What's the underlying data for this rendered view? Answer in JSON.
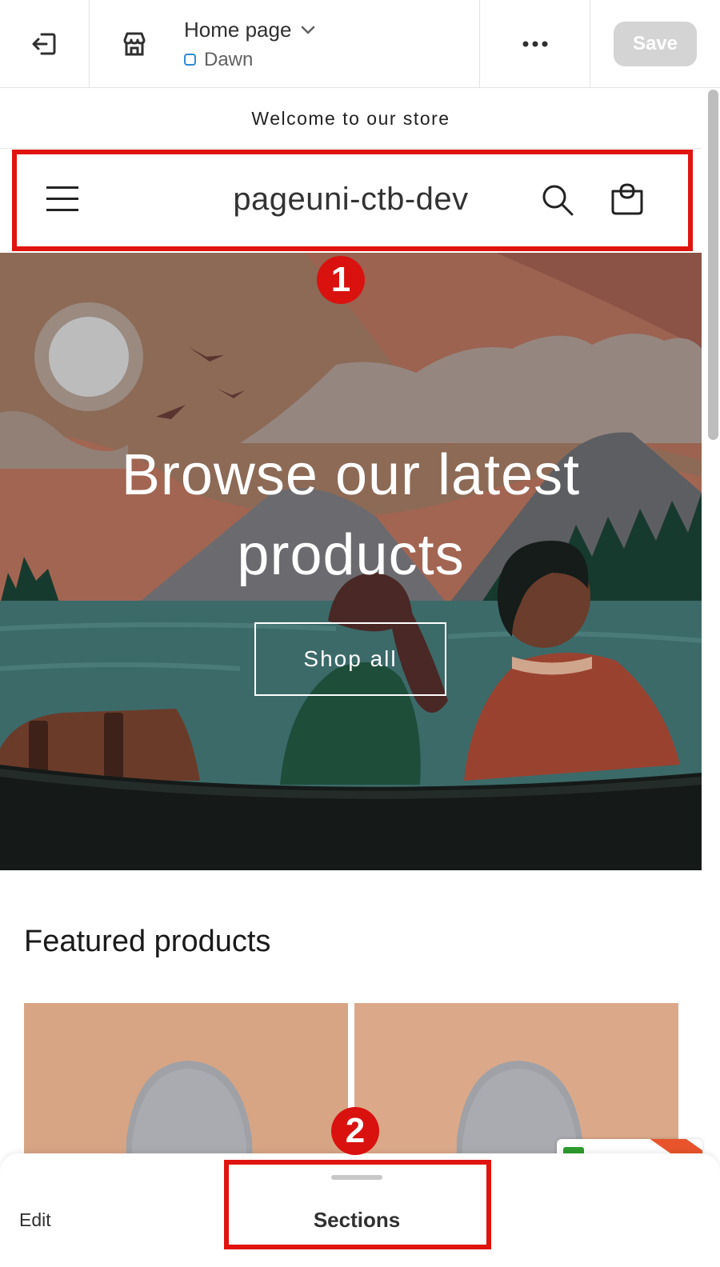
{
  "topbar": {
    "page_name": "Home page",
    "theme_name": "Dawn",
    "save_label": "Save"
  },
  "store": {
    "announcement": "Welcome to our store",
    "logo_text": "pageuni-ctb-dev",
    "hero": {
      "title_line1": "Browse our latest",
      "title_line2": "products",
      "button_label": "Shop all"
    },
    "featured_title": "Featured products"
  },
  "annotations": {
    "badge1": "1",
    "badge2": "2",
    "color": "#e0140f"
  },
  "bottom_panel": {
    "tab_edit": "Edit",
    "tab_sections": "Sections"
  },
  "icons": [
    "exit-icon",
    "store-icon",
    "chevron-down-icon",
    "more-icon",
    "menu-icon",
    "search-icon",
    "cart-icon"
  ]
}
